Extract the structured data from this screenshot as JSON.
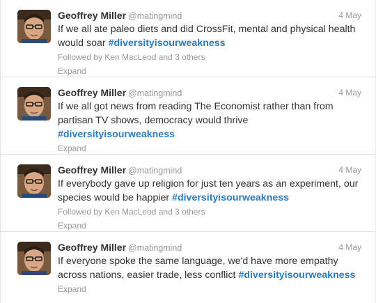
{
  "tweets": [
    {
      "name": "Geoffrey Miller",
      "handle": "@matingmind",
      "date": "4 May",
      "text": "If we all ate paleo diets and did CrossFit, mental and physical health would soar ",
      "hashtag": "#diversityisourweakness",
      "followed_by": "Followed by Ken MacLeod and 3 others",
      "expand": "Expand"
    },
    {
      "name": "Geoffrey Miller",
      "handle": "@matingmind",
      "date": "4 May",
      "text": "If we all got news from reading The Economist rather than from partisan TV shows, democracy would thrive ",
      "hashtag": "#diversityisourweakness",
      "expand": "Expand"
    },
    {
      "name": "Geoffrey Miller",
      "handle": "@matingmind",
      "date": "4 May",
      "text": "If everybody gave up religion for just ten years as an experiment, our species would be happier ",
      "hashtag": "#diversityisourweakness",
      "followed_by": "Followed by Ken MacLeod and 3 others",
      "expand": "Expand"
    },
    {
      "name": "Geoffrey Miller",
      "handle": "@matingmind",
      "date": "4 May",
      "text": "If everyone spoke the same language, we'd have more empathy across nations, easier trade, less conflict ",
      "hashtag": "#diversityisourweakness",
      "expand": "Expand"
    }
  ]
}
